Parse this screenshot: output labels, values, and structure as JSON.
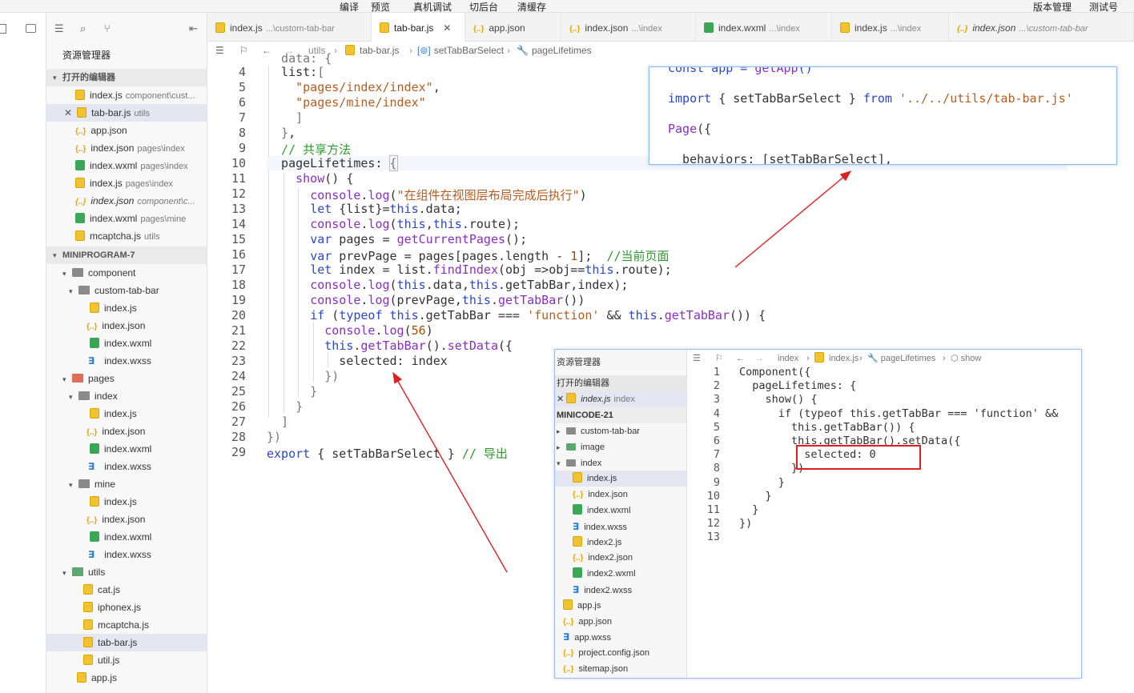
{
  "topbar": {
    "items": [
      "编译",
      "预览",
      "真机调试",
      "切后台",
      "清缓存",
      "版本管理",
      "测试号"
    ]
  },
  "explorer": {
    "title": "资源管理器",
    "open_editors_label": "打开的编辑器",
    "open_files": [
      {
        "name": "index.js",
        "hint": "component\\cust..."
      },
      {
        "name": "tab-bar.js",
        "hint": "utils"
      },
      {
        "name": "app.json",
        "hint": ""
      },
      {
        "name": "index.json",
        "hint": "pages\\index"
      },
      {
        "name": "index.wxml",
        "hint": "pages\\index"
      },
      {
        "name": "index.js",
        "hint": "pages\\index"
      },
      {
        "name": "index.json",
        "hint": "component\\c..."
      },
      {
        "name": "index.wxml",
        "hint": "pages\\mine"
      },
      {
        "name": "mcaptcha.js",
        "hint": "utils"
      }
    ],
    "project_label": "MINIPROGRAM-7",
    "tree": [
      "component",
      "custom-tab-bar",
      "index.js",
      "index.json",
      "index.wxml",
      "index.wxss",
      "pages",
      "index",
      "index.js",
      "index.json",
      "index.wxml",
      "index.wxss",
      "mine",
      "index.js",
      "index.json",
      "index.wxml",
      "index.wxss",
      "utils",
      "cat.js",
      "iphonex.js",
      "mcaptcha.js",
      "tab-bar.js",
      "util.js",
      "app.js"
    ]
  },
  "tabs": [
    {
      "name": "index.js",
      "hint": "...\\custom-tab-bar"
    },
    {
      "name": "tab-bar.js",
      "hint": ""
    },
    {
      "name": "app.json",
      "hint": ""
    },
    {
      "name": "index.json",
      "hint": "...\\index"
    },
    {
      "name": "index.wxml",
      "hint": "...\\index"
    },
    {
      "name": "index.js",
      "hint": "...\\index"
    },
    {
      "name": "index.json",
      "hint": "...\\custom-tab-bar"
    }
  ],
  "breadcrumb": [
    "utils",
    "tab-bar.js",
    "setTabBarSelect",
    "pageLifetimes"
  ],
  "editor": {
    "line_numbers": [
      "4",
      "5",
      "6",
      "7",
      "8",
      "9",
      "10",
      "11",
      "12",
      "13",
      "14",
      "15",
      "16",
      "17",
      "18",
      "19",
      "20",
      "21",
      "22",
      "23",
      "24",
      "25",
      "26",
      "27",
      "28",
      "29"
    ],
    "lines": [
      "    data: {",
      "  list:[",
      "    \"pages/index/index\",",
      "    \"pages/mine/index\"",
      "    ]",
      "  },",
      "  // 共享方法",
      "  pageLifetimes: {",
      "    show() {",
      "      console.log(\"在组件在视图层布局完成后执行\")",
      "      let {list}=this.data;",
      "      console.log(this,this.route);",
      "      var pages = getCurrentPages();",
      "      var prevPage = pages[pages.length - 1];  //当前页面",
      "      let index = list.findIndex(obj =>obj==this.route);",
      "      console.log(this.data,this.getTabBar,index);",
      "      console.log(prevPage,this.getTabBar())",
      "      if (typeof this.getTabBar === 'function' && this.getTabBar()) {",
      "        console.log(56)",
      "        this.getTabBar().setData({",
      "          selected: index",
      "        })",
      "      }",
      "    }",
      "  }",
      "})",
      "export { setTabBarSelect } // 导出"
    ]
  },
  "popup1": {
    "lines": [
      "const app = getApp()",
      "",
      "import { setTabBarSelect } from '../../utils/tab-bar.js'",
      "",
      "Page({",
      "",
      "  behaviors: [setTabBarSelect],"
    ]
  },
  "popup2": {
    "explorer_title": "资源管理器",
    "open_editors_label": "打开的编辑器",
    "open_file": "index.js",
    "open_file_hint": "index",
    "project_label": "MINICODE-21",
    "tree": [
      "custom-tab-bar",
      "image",
      "index",
      "index.js",
      "index.json",
      "index.wxml",
      "index.wxss",
      "index2.js",
      "index2.json",
      "index2.wxml",
      "index2.wxss",
      "app.js",
      "app.json",
      "app.wxss",
      "project.config.json",
      "sitemap.json"
    ],
    "breadcrumb": [
      "index",
      "index.js",
      "pageLifetimes",
      "show"
    ],
    "line_numbers": [
      "1",
      "2",
      "3",
      "4",
      "5",
      "6",
      "7",
      "8",
      "9",
      "10",
      "11",
      "12",
      "13"
    ],
    "lines": [
      "Component({",
      "  pageLifetimes: {",
      "    show() {",
      "      if (typeof this.getTabBar === 'function' &&",
      "        this.getTabBar()) {",
      "        this.getTabBar().setData({",
      "          selected: 0",
      "        })",
      "      }",
      "    }",
      "  }",
      "})",
      ""
    ]
  },
  "colors": {
    "annotation": "#e02020",
    "accent": "#2c46cc",
    "string": "#b85c1f",
    "comment": "#2e9a2e"
  }
}
